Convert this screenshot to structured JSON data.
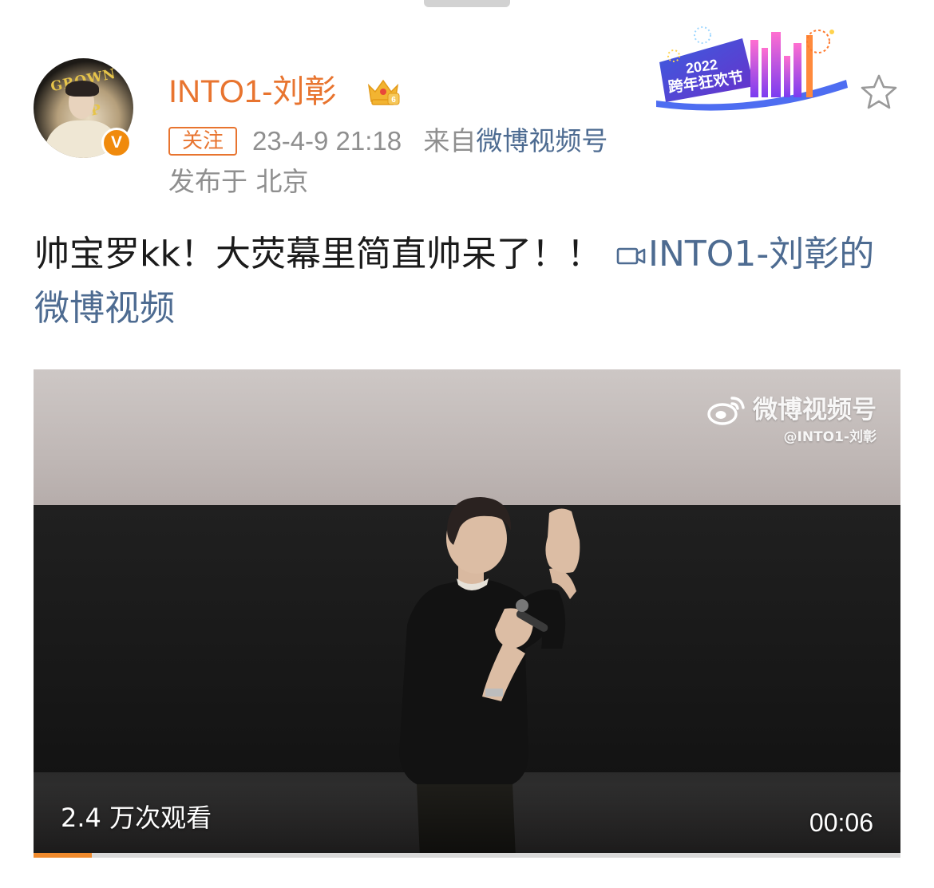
{
  "header": {
    "username": "INTO1-刘彰",
    "follow_label": "关注",
    "timestamp": "23-4-9 21:18",
    "source_prefix": "来自",
    "source_name": "微博视频号",
    "location": "发布于 北京",
    "banner_text": "2022 跨年狂欢节"
  },
  "post": {
    "text": "帅宝罗kk！大荧幕里简直帅呆了！！",
    "video_link": "INTO1-刘彰的微博视频"
  },
  "video": {
    "watermark_title": "微博视频号",
    "watermark_handle": "@INTO1-刘彰",
    "views": "2.4 万次观看",
    "duration": "00:06",
    "progress_fraction": 0.067
  },
  "icons": {
    "avatar_badge": "verified-v-icon",
    "crown": "crown-vip-icon",
    "star": "star-favorite-icon",
    "video": "video-camera-icon",
    "weibo": "weibo-logo-icon"
  },
  "colors": {
    "username": "#e8742f",
    "link": "#4d6b91",
    "meta": "#8f8f8f",
    "progress": "#f08a2c"
  }
}
